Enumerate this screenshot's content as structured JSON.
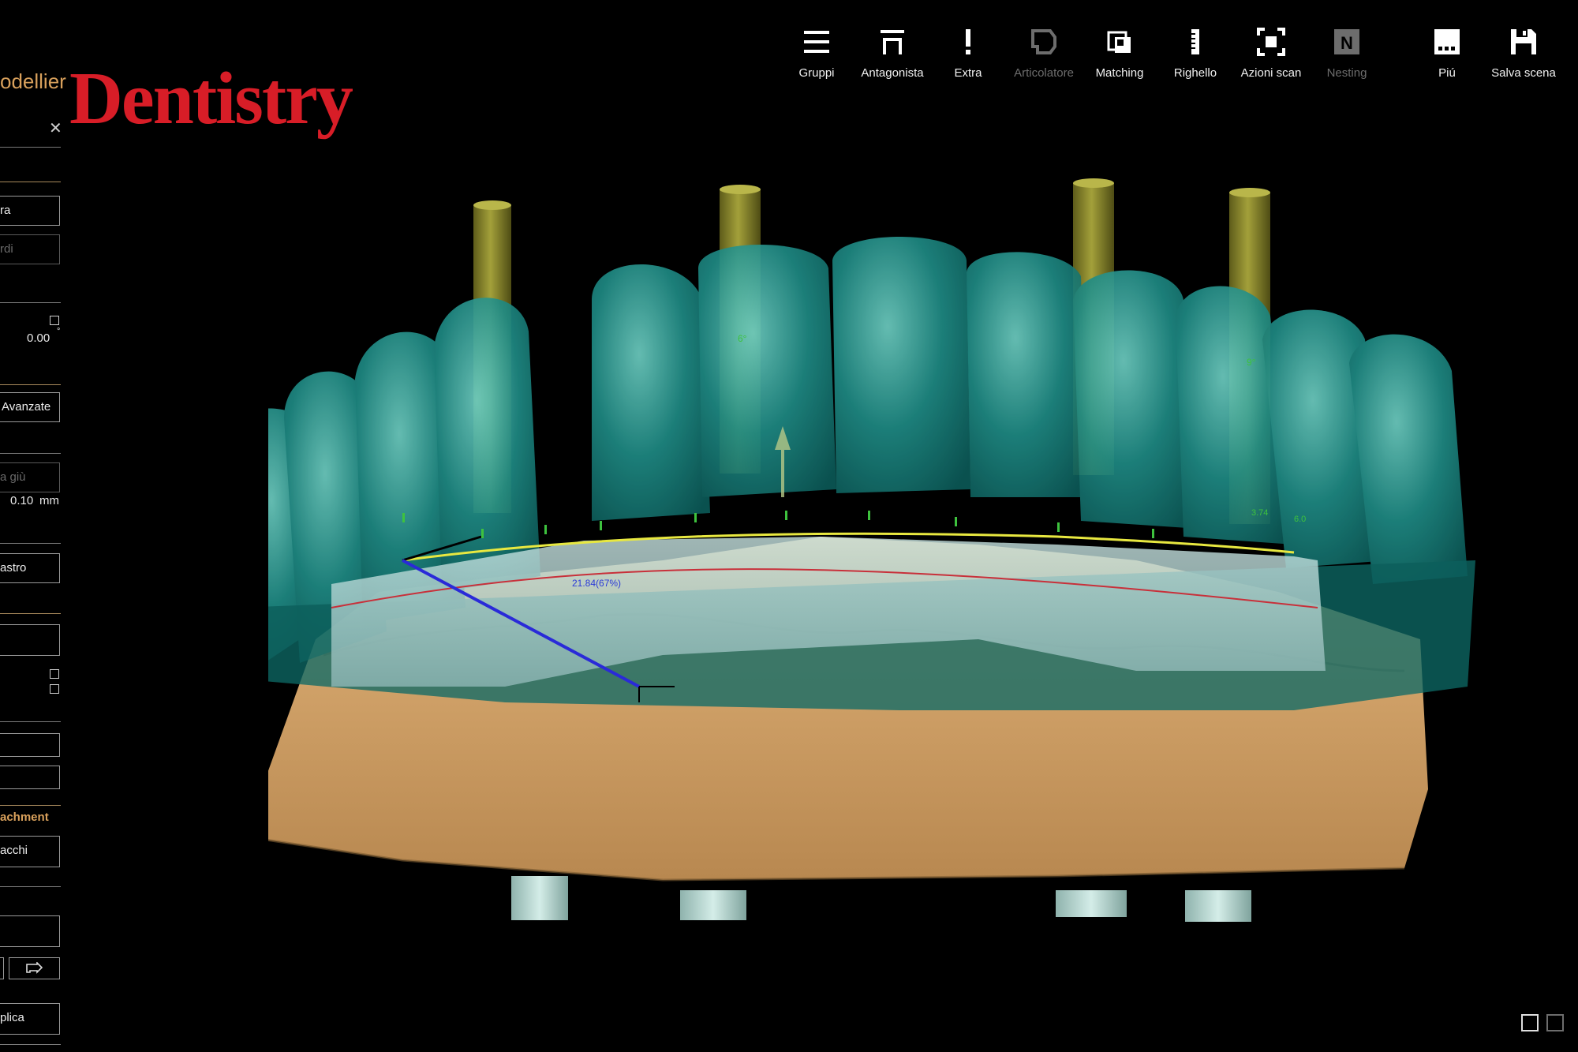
{
  "app": {
    "title": "odellier",
    "brand": "Dentistry"
  },
  "toolbar": {
    "items": [
      {
        "label": "Gruppi",
        "icon": "menu-icon",
        "enabled": true
      },
      {
        "label": "Antagonista",
        "icon": "antagonist-icon",
        "enabled": true
      },
      {
        "label": "Extra",
        "icon": "exclamation-icon",
        "enabled": true
      },
      {
        "label": "Articolatore",
        "icon": "articulator-icon",
        "enabled": false
      },
      {
        "label": "Matching",
        "icon": "matching-icon",
        "enabled": true
      },
      {
        "label": "Righello",
        "icon": "ruler-icon",
        "enabled": true
      },
      {
        "label": "Azioni scan",
        "icon": "scan-actions-icon",
        "enabled": true
      },
      {
        "label": "Nesting",
        "icon": "nesting-icon",
        "enabled": false
      },
      {
        "label": "Piú",
        "icon": "more-icon",
        "enabled": true
      },
      {
        "label": "Salva scena",
        "icon": "save-icon",
        "enabled": true
      }
    ]
  },
  "panel": {
    "close": "✕",
    "field1": "ra",
    "field2": "rdi",
    "angle_value": "0.00",
    "angle_unit": "°",
    "advanced_button": "Avanzate",
    "offset_placeholder": "a giù",
    "offset_value": "0.10",
    "offset_unit": "mm",
    "field_astro": "astro",
    "attachment_header": "achment",
    "attachments_button": "acchi",
    "apply_button": "plica"
  },
  "viewport": {
    "measure_label": "21.84(67%)",
    "angle_labels": [
      "6°",
      "9°"
    ],
    "measure_small": [
      "3.74",
      "6.0"
    ]
  },
  "colors": {
    "brand_red": "#d81d27",
    "accent_orange": "#d9a15c",
    "teeth_teal": "#1f8c86",
    "model_tan": "#d4a36c",
    "implant_olive": "#8d8a2b"
  }
}
